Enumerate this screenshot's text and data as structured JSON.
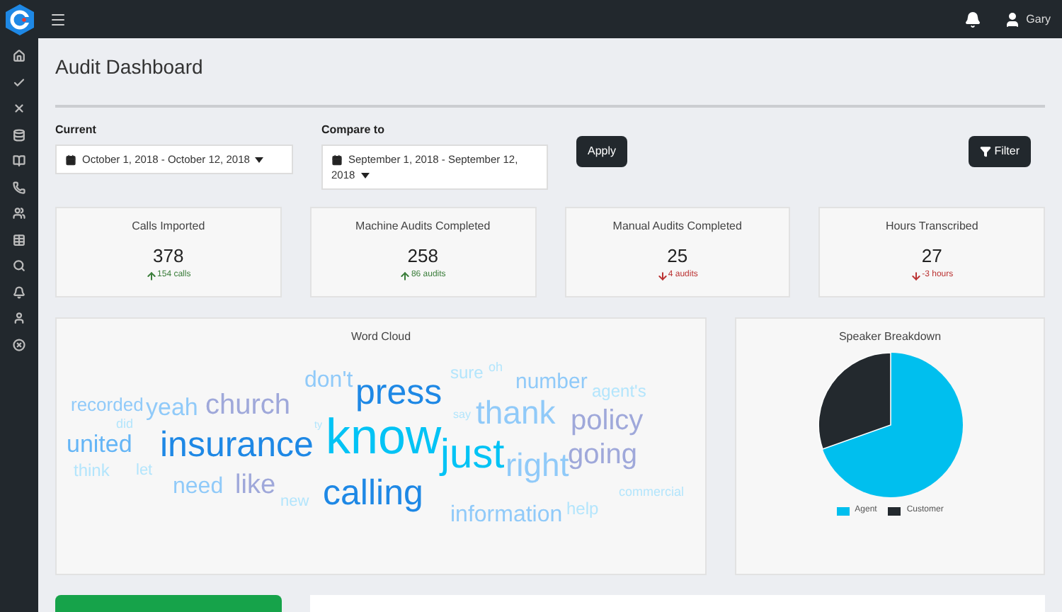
{
  "topbar": {
    "user": "Gary"
  },
  "page_title": "Audit Dashboard",
  "filters": {
    "current": {
      "label": "Current",
      "value": "October 1, 2018 - October 12, 2018"
    },
    "compare": {
      "label": "Compare to",
      "value": "September 1, 2018 - September 12, 2018"
    },
    "apply": "Apply",
    "filter": "Filter"
  },
  "stats": [
    {
      "title": "Calls Imported",
      "value": "378",
      "change": "154 calls",
      "kind": "increase"
    },
    {
      "title": "Machine Audits Completed",
      "value": "258",
      "change": "86 audits",
      "kind": "increase"
    },
    {
      "title": "Manual Audits Completed",
      "value": "25",
      "change": "4 audits",
      "kind": "decrease"
    },
    {
      "title": "Hours Transcribed",
      "value": "27",
      "change": "-3 hours",
      "kind": "decrease"
    }
  ],
  "word_cloud": {
    "title": "Word Cloud",
    "words": [
      {
        "text": "don't",
        "color": "#90caf9"
      },
      {
        "text": "press",
        "color": "#1e88e5"
      },
      {
        "text": "sure",
        "color": "#b3e5fc"
      },
      {
        "text": "oh",
        "color": "#b3e5fc"
      },
      {
        "text": "number",
        "color": "#90caf9"
      },
      {
        "text": "agent's",
        "color": "#b3e5fc"
      },
      {
        "text": "recorded",
        "color": "#90caf9"
      },
      {
        "text": "yeah",
        "color": "#90caf9"
      },
      {
        "text": "church",
        "color": "#9fa8da"
      },
      {
        "text": "did",
        "color": "#b3e5fc"
      },
      {
        "text": "united",
        "color": "#64b5f6"
      },
      {
        "text": "insurance",
        "color": "#1e88e5"
      },
      {
        "text": "ty",
        "color": "#b3e5fc"
      },
      {
        "text": "know",
        "color": "#03c3f5"
      },
      {
        "text": "say",
        "color": "#b3e5fc"
      },
      {
        "text": "thank",
        "color": "#90caf9"
      },
      {
        "text": "policy",
        "color": "#9fa8da"
      },
      {
        "text": "think",
        "color": "#b3e5fc"
      },
      {
        "text": "let",
        "color": "#b3e5fc"
      },
      {
        "text": "just",
        "color": "#03c3f5"
      },
      {
        "text": "right",
        "color": "#90caf9"
      },
      {
        "text": "going",
        "color": "#9fa8da"
      },
      {
        "text": "need",
        "color": "#90caf9"
      },
      {
        "text": "like",
        "color": "#9fa8da"
      },
      {
        "text": "new",
        "color": "#b3e5fc"
      },
      {
        "text": "calling",
        "color": "#1e88e5"
      },
      {
        "text": "information",
        "color": "#90caf9"
      },
      {
        "text": "help",
        "color": "#b3e5fc"
      },
      {
        "text": "commercial",
        "color": "#b3e5fc"
      }
    ]
  },
  "speaker_breakdown": {
    "title": "Speaker Breakdown",
    "legend": [
      {
        "label": "Agent",
        "color": "#00bfee"
      },
      {
        "label": "Customer",
        "color": "#23292e"
      }
    ]
  }
}
